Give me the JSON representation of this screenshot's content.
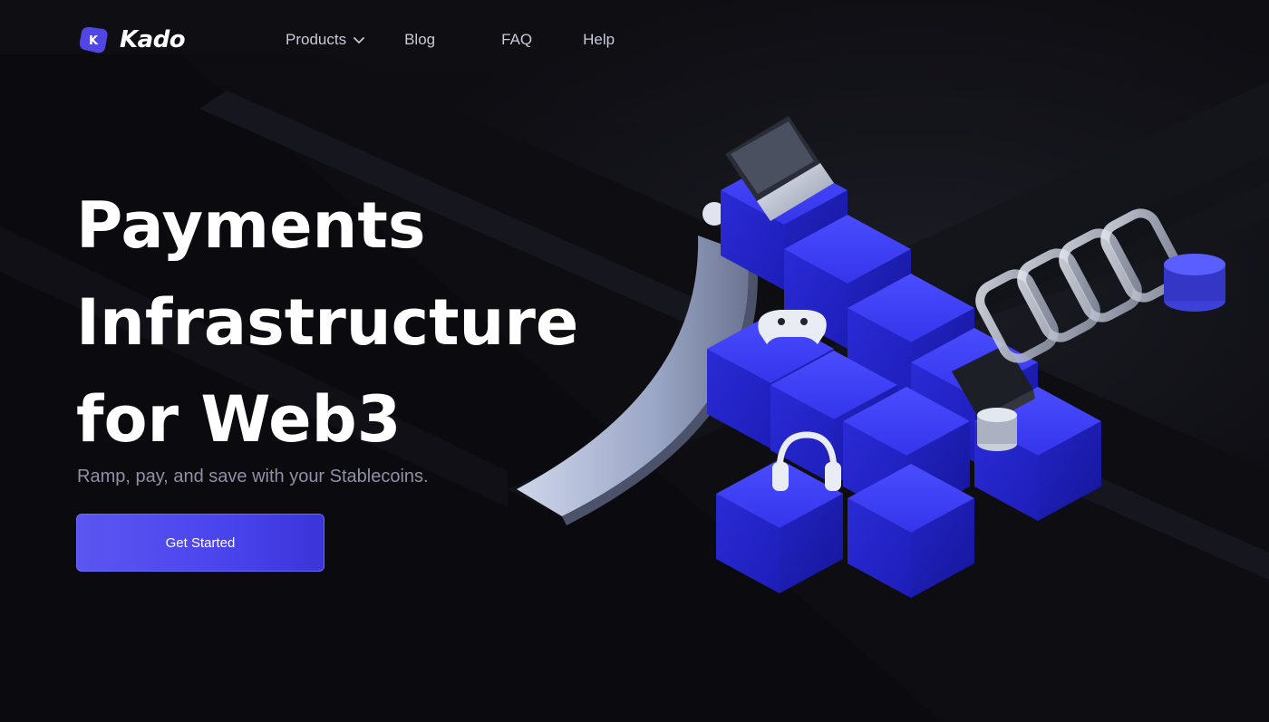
{
  "brand": {
    "name": "Kado",
    "logo_letter": "K",
    "logo_color": "#4f46e5"
  },
  "nav": {
    "items": [
      {
        "label": "Products",
        "has_dropdown": true
      },
      {
        "label": "Blog"
      },
      {
        "label": "FAQ"
      },
      {
        "label": "Help"
      }
    ]
  },
  "hero": {
    "title_lines": [
      "Payments",
      "Infrastructure",
      "for Web3"
    ],
    "subtitle": "Ramp, pay, and save with your Stablecoins.",
    "cta_label": "Get Started"
  },
  "colors": {
    "background": "#0b0b10",
    "accent": "#4f46e5",
    "block_blue": "#2b2bd9",
    "subtitle": "#8f90a6"
  },
  "illustration": {
    "objects": [
      "laptop-icon",
      "gamepad-icon",
      "headphones-icon",
      "wallet-icon",
      "coin-stack-icon",
      "chain-link-icon"
    ]
  }
}
